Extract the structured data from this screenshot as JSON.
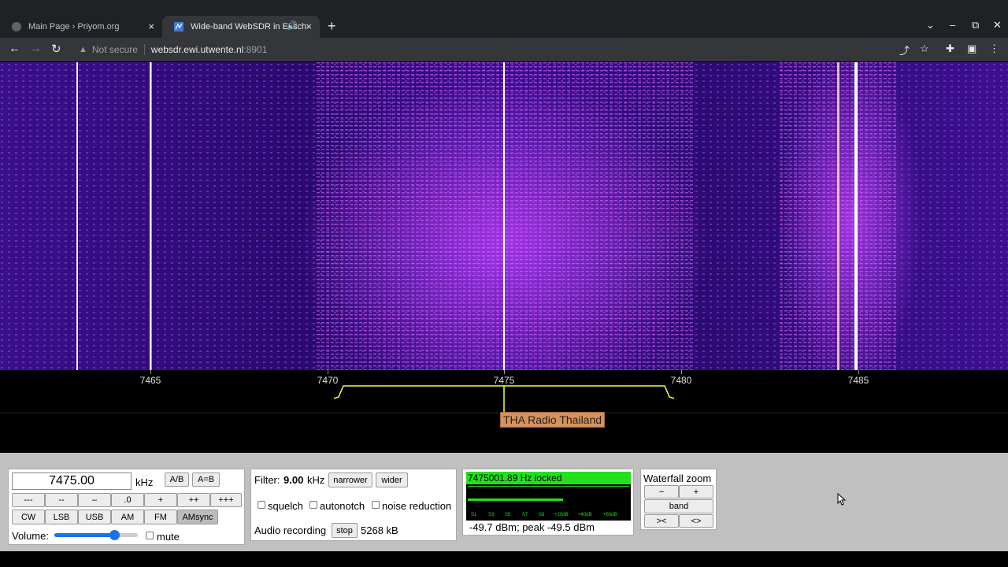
{
  "browser": {
    "tabs": [
      {
        "title": "Main Page › Priyom.org",
        "close": "×"
      },
      {
        "title": "Wide-band WebSDR in Ensch",
        "close": "×",
        "audio_icon": "speaker-icon"
      }
    ],
    "new_tab": "+",
    "window_controls": {
      "dropdown": "⌄",
      "minimize": "–",
      "restore": "⧉",
      "close": "✕"
    },
    "nav": {
      "back": "←",
      "forward": "→",
      "reload": "↻"
    },
    "security_label": "Not secure",
    "url_host": "websdr.ewi.utwente.nl",
    "url_port": ":8901"
  },
  "frequency_scale": {
    "ticks": [
      "7465",
      "7470",
      "7475",
      "7480",
      "7485"
    ]
  },
  "station_label": "THA Radio Thailand",
  "tuning": {
    "frequency_value": "7475.00",
    "unit": "kHz",
    "ab_label": "A/B",
    "aeqb_label": "A=B",
    "step_buttons": [
      "---",
      "--",
      "–",
      ".0",
      "+",
      "++",
      "+++"
    ],
    "modes": [
      "CW",
      "LSB",
      "USB",
      "AM",
      "FM",
      "AMsync"
    ],
    "selected_mode": "AMsync",
    "volume_label": "Volume:",
    "volume_level": 0.72,
    "mute_label": "mute"
  },
  "filter": {
    "label": "Filter:",
    "value": "9.00",
    "unit": "kHz",
    "narrower_label": "narrower",
    "wider_label": "wider",
    "squelch_label": "squelch",
    "autonotch_label": "autonotch",
    "noise_reduction_label": "noise reduction",
    "audio_recording_label": "Audio recording",
    "stop_label": "stop",
    "recording_size": "5268 kB"
  },
  "smeter": {
    "lock_text": "7475001.89 Hz locked",
    "scale_labels": [
      "S1",
      "S3",
      "S5",
      "S7",
      "S9",
      "+20dB",
      "+40dB",
      "+60dB"
    ],
    "bar_level": 0.59,
    "readout": "-49.7 dBm; peak  -49.5 dBm",
    "colors": {
      "lock_bg": "#22e01e",
      "bar": "#22e01e",
      "meter_bg": "#000000"
    }
  },
  "zoom": {
    "title": "Waterfall zoom",
    "minus": "−",
    "plus": "+",
    "band": "band",
    "narrow": "><",
    "wide": "<>"
  }
}
